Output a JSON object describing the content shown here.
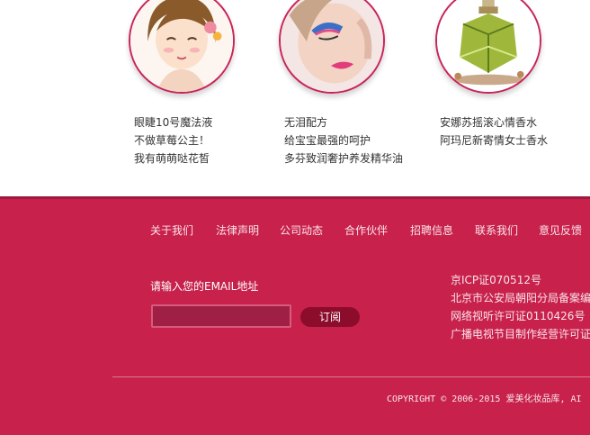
{
  "products": [
    {
      "image": "cartoon-girl-portrait",
      "lines": [
        "眼睫10号魔法液",
        "不做草莓公主！",
        "我有萌萌哒花皙"
      ]
    },
    {
      "image": "makeup-model-portrait",
      "lines": [
        "无泪配方",
        "给宝宝最强的呵护",
        "多芬致润奢护养发精华油"
      ]
    },
    {
      "image": "perfume-bottle",
      "lines": [
        "安娜苏摇滚心情香水",
        "阿玛尼新寄情女士香水"
      ]
    }
  ],
  "footer": {
    "nav": [
      "关于我们",
      "法律声明",
      "公司动态",
      "合作伙伴",
      "招聘信息",
      "联系我们",
      "意见反馈"
    ],
    "email_label": "请输入您的EMAIL地址",
    "email_value": "",
    "subscribe_label": "订阅",
    "licenses": [
      "京ICP证070512号",
      "北京市公安局朝阳分局备案编",
      "网络视听许可证0110426号",
      "广播电视节目制作经营许可证"
    ],
    "copyright": "COPYRIGHT © 2006-2015 爱美化妆品库, AI"
  },
  "colors": {
    "accent": "#c7214c",
    "dark_accent": "#8c0c2c",
    "circle_border": "#c8245a"
  }
}
